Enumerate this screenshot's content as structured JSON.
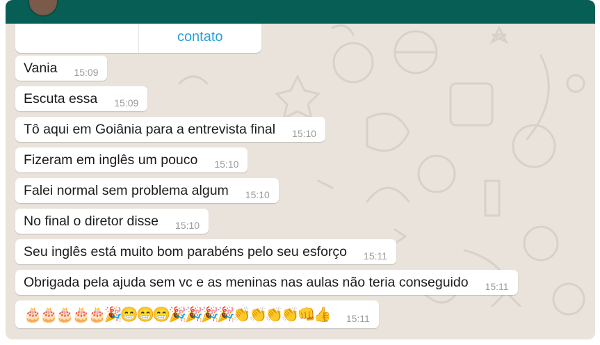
{
  "contact_card": {
    "action_label": "contato"
  },
  "messages": [
    {
      "text": "Vania",
      "time": "15:09"
    },
    {
      "text": "Escuta essa",
      "time": "15:09"
    },
    {
      "text": "Tô aqui em Goiânia para a entrevista final",
      "time": "15:10"
    },
    {
      "text": "Fizeram em inglês um pouco",
      "time": "15:10"
    },
    {
      "text": "Falei normal sem problema algum",
      "time": "15:10"
    },
    {
      "text": "No final o diretor disse",
      "time": "15:10"
    },
    {
      "text": "Seu inglês está muito bom parabéns pelo seu esforço",
      "time": "15:11"
    },
    {
      "text": "Obrigada pela ajuda sem vc e as meninas nas aulas não teria conseguido",
      "time": "15:11"
    },
    {
      "text": "🎂🎂🎂🎂🎂🎉😁😁😁🎉🎉🎉🎉👏👏👏👏👊👍",
      "time": "15:11"
    }
  ],
  "colors": {
    "header": "#075e54",
    "wallpaper": "#e9e3dc",
    "bubble": "#ffffff",
    "link": "#2b9fd8",
    "timestamp": "#9a9a9a"
  }
}
